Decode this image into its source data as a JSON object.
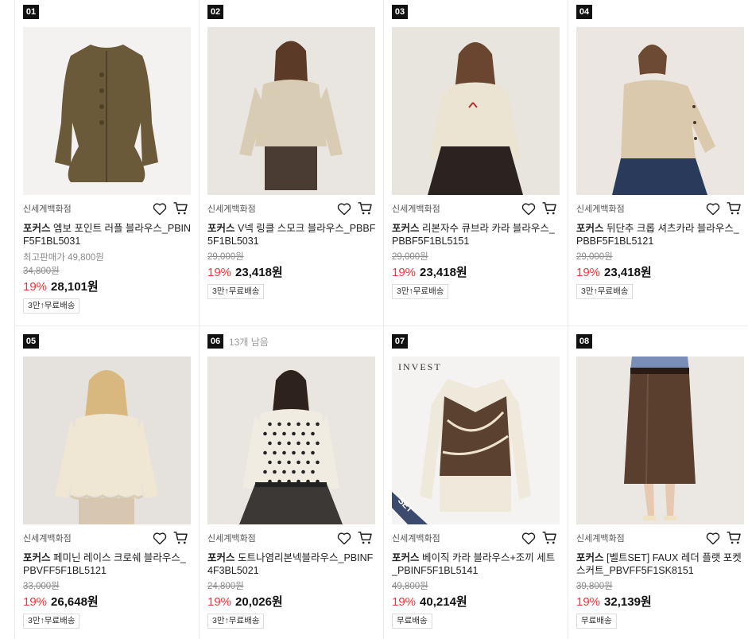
{
  "products": [
    {
      "rank": "01",
      "stock": "",
      "seller": "신세계백화점",
      "brand": "포커스",
      "name": "엠보 포인트 러플 블라우스_PBINF5F1BL5031",
      "best_price": "최고판매가 49,800원",
      "original_price": "34,800원",
      "discount": "19%",
      "price": "28,101원",
      "shipping": "3만↑무료배송",
      "image": "olive-peplum-jacket"
    },
    {
      "rank": "02",
      "stock": "",
      "seller": "신세계백화점",
      "brand": "포커스",
      "name": "V넥 링클 스모크 블라우스_PBBF5F1BL5031",
      "best_price": "",
      "original_price": "29,000원",
      "discount": "19%",
      "price": "23,418원",
      "shipping": "3만↑무료배송",
      "image": "beige-smock-blouse-model"
    },
    {
      "rank": "03",
      "stock": "",
      "seller": "신세계백화점",
      "brand": "포커스",
      "name": "리본자수 큐브라 카라 블라우스_PBBF5F1BL5151",
      "best_price": "",
      "original_price": "29,000원",
      "discount": "19%",
      "price": "23,418원",
      "shipping": "3만↑무료배송",
      "image": "beige-ribbon-blouse-model"
    },
    {
      "rank": "04",
      "stock": "",
      "seller": "신세계백화점",
      "brand": "포커스",
      "name": "뒤단추 크롭 셔츠카라 블라우스_PBBF5F1BL5121",
      "best_price": "",
      "original_price": "29,000원",
      "discount": "19%",
      "price": "23,418원",
      "shipping": "3만↑무료배송",
      "image": "beige-crop-blouse-model"
    },
    {
      "rank": "05",
      "stock": "",
      "seller": "신세계백화점",
      "brand": "포커스",
      "name": "페미닌 레이스 크로쉐 블라우스_PBVFF5F1BL5121",
      "best_price": "",
      "original_price": "33,000원",
      "discount": "19%",
      "price": "26,648원",
      "shipping": "3만↑무료배송",
      "image": "lace-crochet-blouse-model"
    },
    {
      "rank": "06",
      "stock": "13개 남음",
      "seller": "신세계백화점",
      "brand": "포커스",
      "name": "도트나염리본넥블라우스_PBINF4F3BL5021",
      "best_price": "",
      "original_price": "24,800원",
      "discount": "19%",
      "price": "20,026원",
      "shipping": "3만↑무료배송",
      "image": "dot-ribbon-blouse-model"
    },
    {
      "rank": "07",
      "stock": "",
      "seller": "신세계백화점",
      "brand": "포커스",
      "name": "베이직 카라 블라우스+조끼 세트_PBINF5F1BL5141",
      "best_price": "",
      "original_price": "49,800원",
      "discount": "19%",
      "price": "40,214원",
      "shipping": "무료배송",
      "image": "blouse-vest-set",
      "image_text": "INVEST",
      "ribbon": "SET"
    },
    {
      "rank": "08",
      "stock": "",
      "seller": "신세계백화점",
      "brand": "포커스",
      "name": "[벨트SET] FAUX 레더 플랫 포켓 스커트_PBVFF5F1SK8151",
      "best_price": "",
      "original_price": "39,800원",
      "discount": "19%",
      "price": "32,139원",
      "shipping": "무료배송",
      "image": "leather-skirt-model"
    }
  ],
  "colors": {
    "discount": "#e8383d",
    "rank_bg": "#111111",
    "divider": "#ececec"
  }
}
